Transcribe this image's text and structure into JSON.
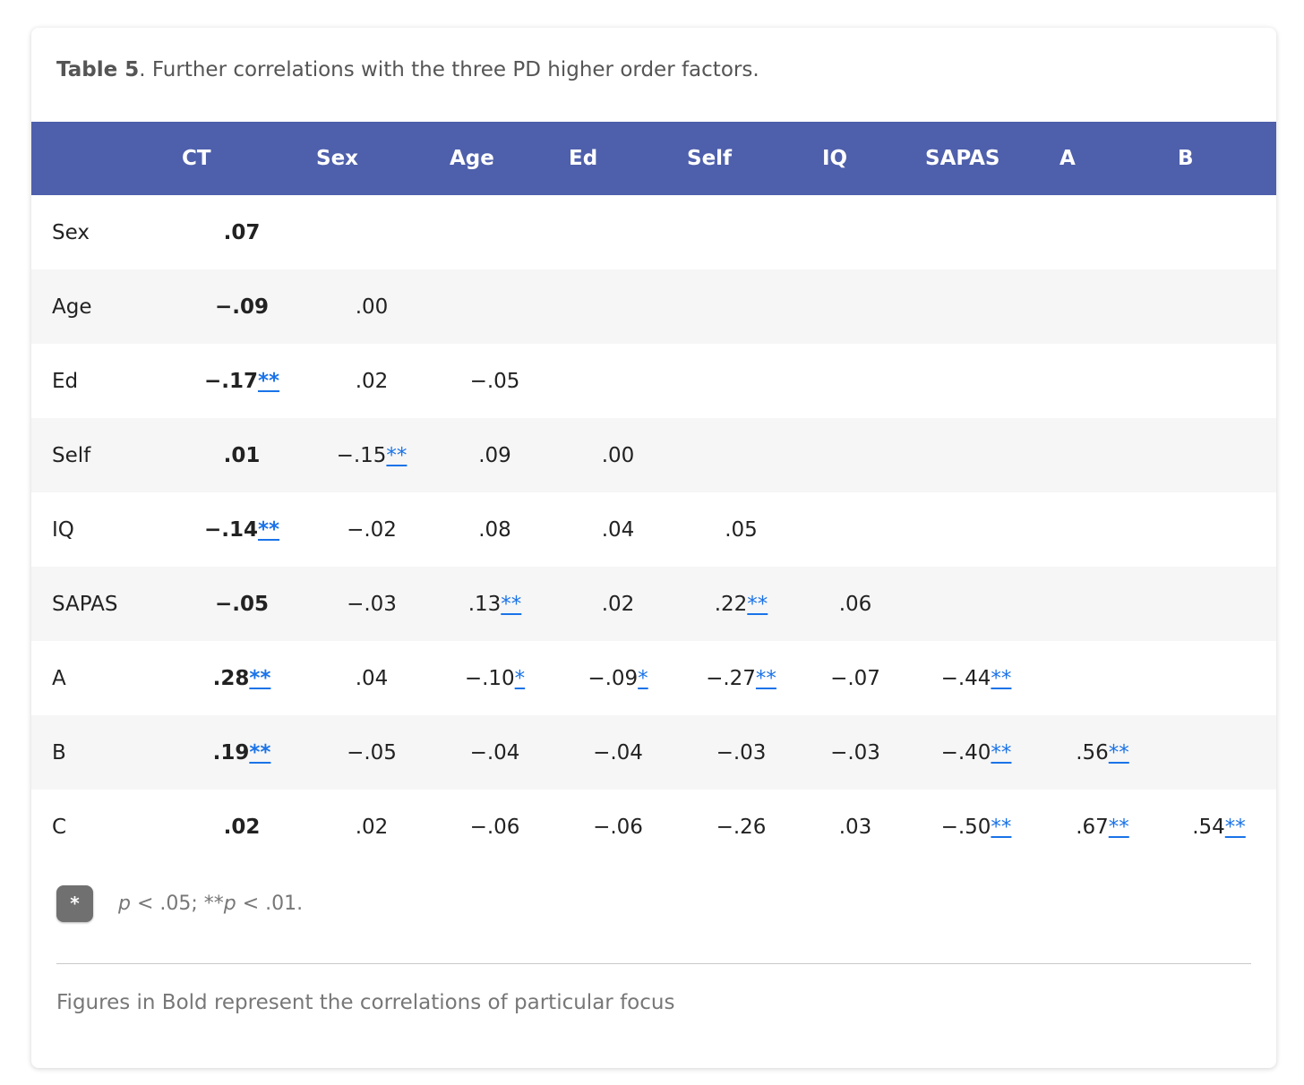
{
  "caption": {
    "label": "Table 5",
    "text": ". Further correlations with the three PD higher order factors."
  },
  "table": {
    "headers": [
      "",
      "CT",
      "Sex",
      "Age",
      "Ed",
      "Self",
      "IQ",
      "SAPAS",
      "A",
      "B"
    ],
    "rows": [
      {
        "label": "Sex",
        "cells": [
          {
            "v": ".07",
            "s": ""
          }
        ]
      },
      {
        "label": "Age",
        "cells": [
          {
            "v": "−.09",
            "s": ""
          },
          {
            "v": ".00",
            "s": ""
          }
        ]
      },
      {
        "label": "Ed",
        "cells": [
          {
            "v": "−.17",
            "s": "**"
          },
          {
            "v": ".02",
            "s": ""
          },
          {
            "v": "−.05",
            "s": ""
          }
        ]
      },
      {
        "label": "Self",
        "cells": [
          {
            "v": ".01",
            "s": ""
          },
          {
            "v": "−.15",
            "s": "**"
          },
          {
            "v": ".09",
            "s": ""
          },
          {
            "v": ".00",
            "s": ""
          }
        ]
      },
      {
        "label": "IQ",
        "cells": [
          {
            "v": "−.14",
            "s": "**"
          },
          {
            "v": "−.02",
            "s": ""
          },
          {
            "v": ".08",
            "s": ""
          },
          {
            "v": ".04",
            "s": ""
          },
          {
            "v": ".05",
            "s": ""
          }
        ]
      },
      {
        "label": "SAPAS",
        "cells": [
          {
            "v": "−.05",
            "s": ""
          },
          {
            "v": "−.03",
            "s": ""
          },
          {
            "v": ".13",
            "s": "**"
          },
          {
            "v": ".02",
            "s": ""
          },
          {
            "v": ".22",
            "s": "**"
          },
          {
            "v": ".06",
            "s": ""
          }
        ]
      },
      {
        "label": "A",
        "cells": [
          {
            "v": ".28",
            "s": "**"
          },
          {
            "v": ".04",
            "s": ""
          },
          {
            "v": "−.10",
            "s": "*"
          },
          {
            "v": "−.09",
            "s": "*"
          },
          {
            "v": "−.27",
            "s": "**"
          },
          {
            "v": "−.07",
            "s": ""
          },
          {
            "v": "−.44",
            "s": "**"
          }
        ]
      },
      {
        "label": "B",
        "cells": [
          {
            "v": ".19",
            "s": "**"
          },
          {
            "v": "−.05",
            "s": ""
          },
          {
            "v": "−.04",
            "s": ""
          },
          {
            "v": "−.04",
            "s": ""
          },
          {
            "v": "−.03",
            "s": ""
          },
          {
            "v": "−.03",
            "s": ""
          },
          {
            "v": "−.40",
            "s": "**"
          },
          {
            "v": ".56",
            "s": "**"
          }
        ]
      },
      {
        "label": "C",
        "cells": [
          {
            "v": ".02",
            "s": ""
          },
          {
            "v": ".02",
            "s": ""
          },
          {
            "v": "−.06",
            "s": ""
          },
          {
            "v": "−.06",
            "s": ""
          },
          {
            "v": "−.26",
            "s": ""
          },
          {
            "v": ".03",
            "s": ""
          },
          {
            "v": "−.50",
            "s": "**"
          },
          {
            "v": ".67",
            "s": "**"
          },
          {
            "v": ".54",
            "s": "**"
          }
        ]
      }
    ]
  },
  "footnote": {
    "badge": "*",
    "p1": "p",
    "t1": " < .05; **",
    "p2": "p",
    "t2": " < .01."
  },
  "note": "Figures in Bold represent the correlations of particular focus",
  "colors": {
    "header_bg": "#4e5fab",
    "link": "#1a73e8",
    "stripe": "#f6f6f6"
  }
}
